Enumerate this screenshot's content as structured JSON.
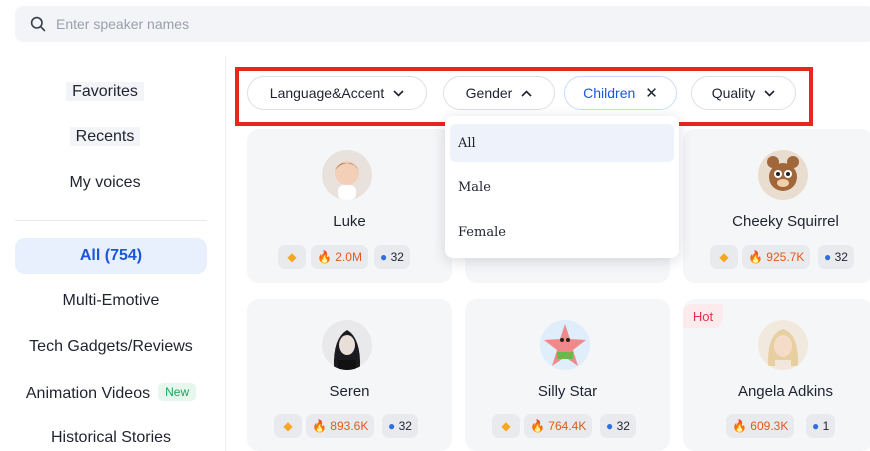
{
  "search": {
    "placeholder": "Enter speaker names"
  },
  "sidebar": {
    "items": [
      "Favorites",
      "Recents",
      "My voices"
    ],
    "all_label": "All",
    "all_count": "(754)",
    "categories": [
      "Multi-Emotive",
      "Tech Gadgets/Reviews",
      "Animation Videos",
      "Historical Stories"
    ],
    "new_badge": "New"
  },
  "filters": {
    "language": "Language&Accent",
    "gender": "Gender",
    "children": "Children",
    "quality": "Quality"
  },
  "gender_dropdown": {
    "options": [
      "All",
      "Male",
      "Female"
    ],
    "selected": "All"
  },
  "colors": {
    "accent": "#1a56db",
    "highlight_box": "#e8261d",
    "hot": "#e0334a",
    "new": "#1ea35a"
  },
  "voices": [
    {
      "name": "Luke",
      "plays": "2.0M",
      "languages": "32"
    },
    {
      "name": "",
      "plays": "",
      "languages": ""
    },
    {
      "name": "Cheeky Squirrel",
      "plays": "925.7K",
      "languages": "32"
    },
    {
      "name": "Seren",
      "plays": "893.6K",
      "languages": "32"
    },
    {
      "name": "Silly Star",
      "plays": "764.4K",
      "languages": "32"
    },
    {
      "name": "Angela Adkins",
      "plays": "609.3K",
      "languages": "1",
      "badge": "Hot"
    }
  ]
}
